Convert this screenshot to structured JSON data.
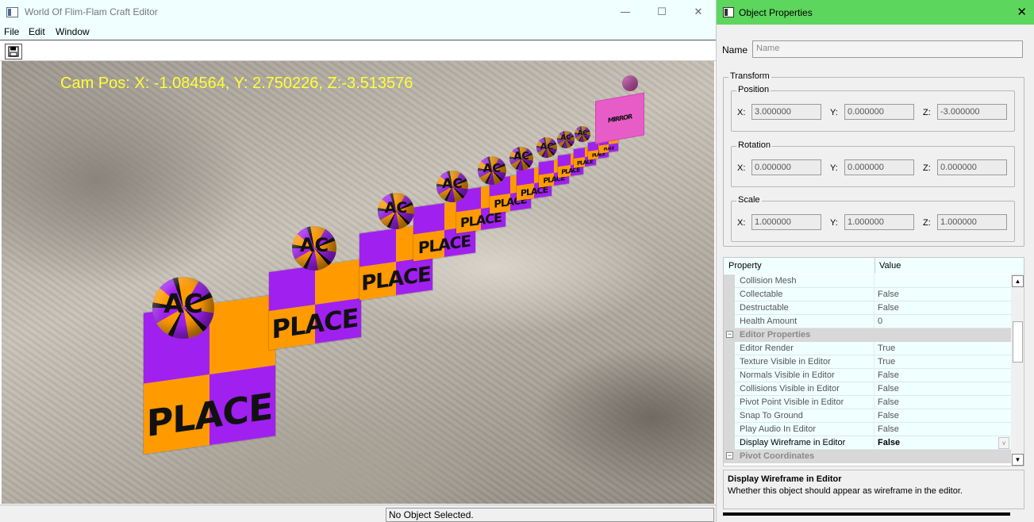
{
  "window": {
    "title": "World Of Flim-Flam Craft Editor",
    "minimize": "—",
    "maximize": "☐",
    "close": "✕",
    "icon": "app-window-icon"
  },
  "menu": {
    "file": "File",
    "edit": "Edit",
    "window": "Window"
  },
  "toolbar": {
    "save_icon": "save-disk-icon"
  },
  "viewport": {
    "cam_pos": "Cam Pos: X: -1.084564, Y: 2.750226, Z:-3.513576",
    "cube_label": "PLACE",
    "far_label": "MIRROR",
    "sphere_label": "AC",
    "colors": {
      "orange": "#ff9a00",
      "purple": "#a020f0",
      "pink": "#e85cc8",
      "hud": "#ffff33"
    }
  },
  "status": {
    "text": "No Object Selected."
  },
  "panel": {
    "title": "Object Properties",
    "close": "✕",
    "name_label": "Name",
    "name_placeholder": "Name",
    "transform_label": "Transform",
    "position": {
      "label": "Position",
      "x_label": "X:",
      "y_label": "Y:",
      "z_label": "Z:",
      "x": "3.000000",
      "y": "0.000000",
      "z": "-3.000000"
    },
    "rotation": {
      "label": "Rotation",
      "x_label": "X:",
      "y_label": "Y:",
      "z_label": "Z:",
      "x": "0.000000",
      "y": "0.000000",
      "z": "0.000000"
    },
    "scale": {
      "label": "Scale",
      "x_label": "X:",
      "y_label": "Y:",
      "z_label": "Z:",
      "x": "1.000000",
      "y": "1.000000",
      "z": "1.000000"
    },
    "grid": {
      "col_property": "Property",
      "col_value": "Value",
      "rows": [
        {
          "type": "prop",
          "name": "Collision Mesh",
          "value": ""
        },
        {
          "type": "prop",
          "name": "Collectable",
          "value": "False"
        },
        {
          "type": "prop",
          "name": "Destructable",
          "value": "False"
        },
        {
          "type": "prop",
          "name": "Health Amount",
          "value": "0"
        },
        {
          "type": "cat",
          "name": "Editor Properties",
          "value": ""
        },
        {
          "type": "prop",
          "name": "Editor Render",
          "value": "True"
        },
        {
          "type": "prop",
          "name": "Texture Visible in Editor",
          "value": "True"
        },
        {
          "type": "prop",
          "name": "Normals Visible in Editor",
          "value": "False"
        },
        {
          "type": "prop",
          "name": "Collisions Visible in Editor",
          "value": "False"
        },
        {
          "type": "prop",
          "name": "Pivot Point Visible in Editor",
          "value": "False"
        },
        {
          "type": "prop",
          "name": "Snap To Ground",
          "value": "False"
        },
        {
          "type": "prop",
          "name": "Play Audio In Editor",
          "value": "False"
        },
        {
          "type": "sel",
          "name": "Display Wireframe in Editor",
          "value": "False"
        },
        {
          "type": "cat",
          "name": "Pivot Coordinates",
          "value": ""
        }
      ]
    },
    "description": {
      "title": "Display Wireframe in Editor",
      "text": "Whether this object should appear as wireframe in the editor."
    }
  }
}
